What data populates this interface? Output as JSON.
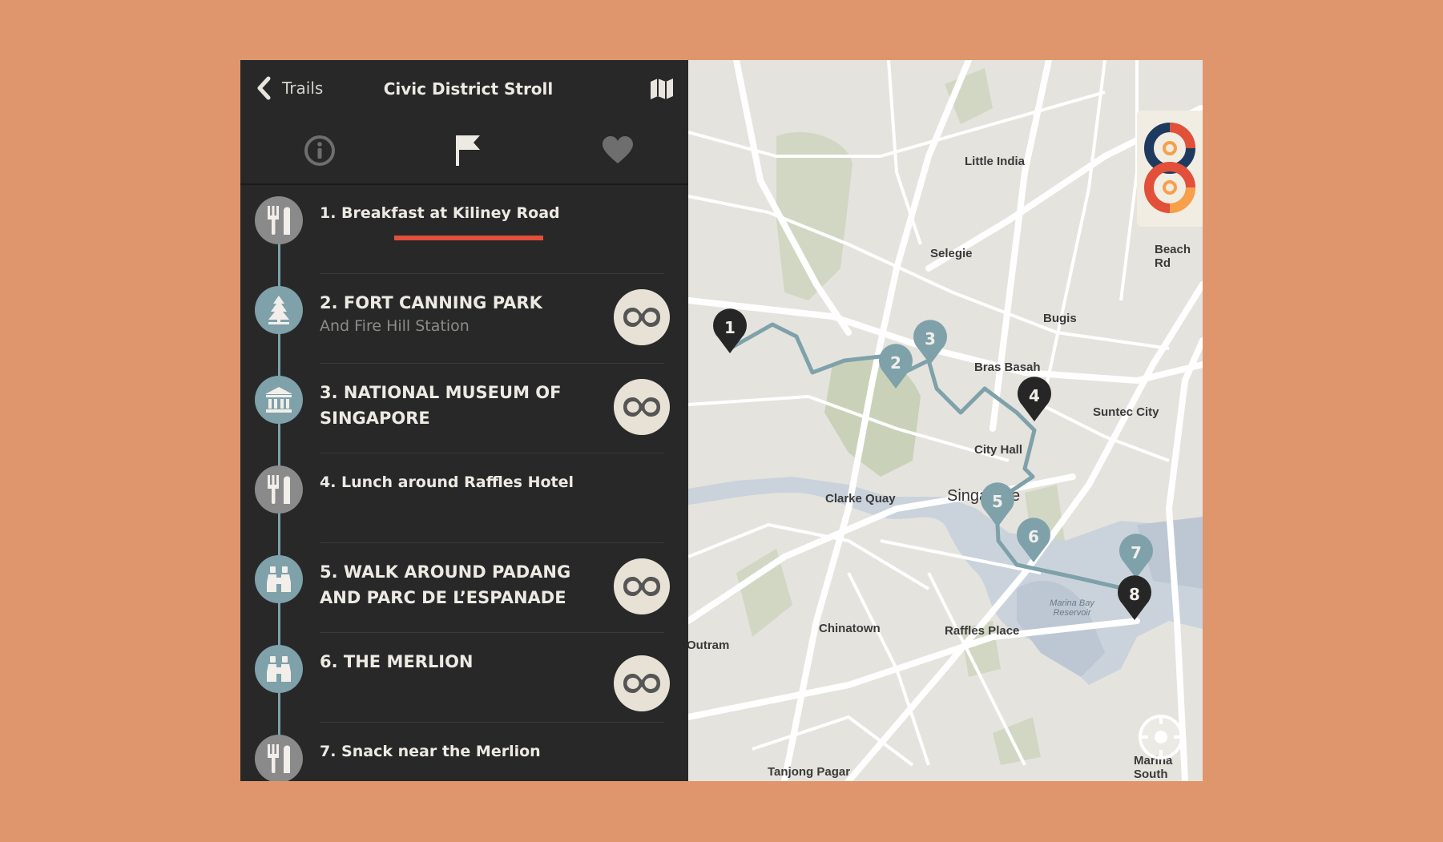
{
  "header": {
    "back_label": "Trails",
    "title": "Civic District Stroll"
  },
  "tabs": [
    {
      "id": "info",
      "icon": "info-icon"
    },
    {
      "id": "stops",
      "icon": "flag-icon",
      "active": true
    },
    {
      "id": "favorites",
      "icon": "heart-icon"
    }
  ],
  "stops": [
    {
      "name": "1.  Breakfast at Kiliney Road",
      "subtitle": "",
      "icon": "fork-knife-icon",
      "style": "grey",
      "vr": false
    },
    {
      "name": "2. FORT CANNING PARK",
      "subtitle": "And Fire Hill Station",
      "icon": "tree-icon",
      "style": "teal",
      "vr": true
    },
    {
      "name": "3. NATIONAL MUSEUM OF SINGAPORE",
      "subtitle": "",
      "icon": "museum-icon",
      "style": "teal",
      "vr": true
    },
    {
      "name": "4. Lunch around Raffles Hotel",
      "subtitle": "",
      "icon": "fork-knife-icon",
      "style": "grey",
      "vr": false
    },
    {
      "name": "5. WALK AROUND PADANG AND PARC DE L’ESPANADE",
      "subtitle": "",
      "icon": "binoculars-icon",
      "style": "teal",
      "vr": true
    },
    {
      "name": "6. THE MERLION",
      "subtitle": "",
      "icon": "binoculars-icon",
      "style": "teal",
      "vr": true
    },
    {
      "name": "7. Snack near the Merlion",
      "subtitle": "",
      "icon": "fork-knife-icon",
      "style": "grey",
      "vr": false
    }
  ],
  "map": {
    "pins": [
      {
        "label": "1",
        "style": "dark"
      },
      {
        "label": "2",
        "style": "teal"
      },
      {
        "label": "3",
        "style": "teal"
      },
      {
        "label": "4",
        "style": "dark"
      },
      {
        "label": "5",
        "style": "teal"
      },
      {
        "label": "6",
        "style": "teal"
      },
      {
        "label": "7",
        "style": "teal"
      },
      {
        "label": "8",
        "style": "dark"
      }
    ],
    "labels": {
      "little_india": "Little India",
      "selegie": "Selegie",
      "bugis": "Bugis",
      "bras_basah": "Bras Basah",
      "suntec_city": "Suntec City",
      "city_hall": "City Hall",
      "clarke_quay": "Clarke Quay",
      "singapore": "Singapore",
      "chinatown": "Chinatown",
      "raffles_place": "Raffles Place",
      "marina_bay_reservoir": "Marina Bay Reservoir",
      "outram": "Outram",
      "tanjong_pagar": "Tanjong Pagar",
      "marina_south": "Marina South",
      "beach_rd": "Beach Rd"
    }
  },
  "colors": {
    "accent": "#E2503A",
    "teal": "#7EA1AA",
    "panel": "#282828",
    "background": "#E0966D"
  }
}
